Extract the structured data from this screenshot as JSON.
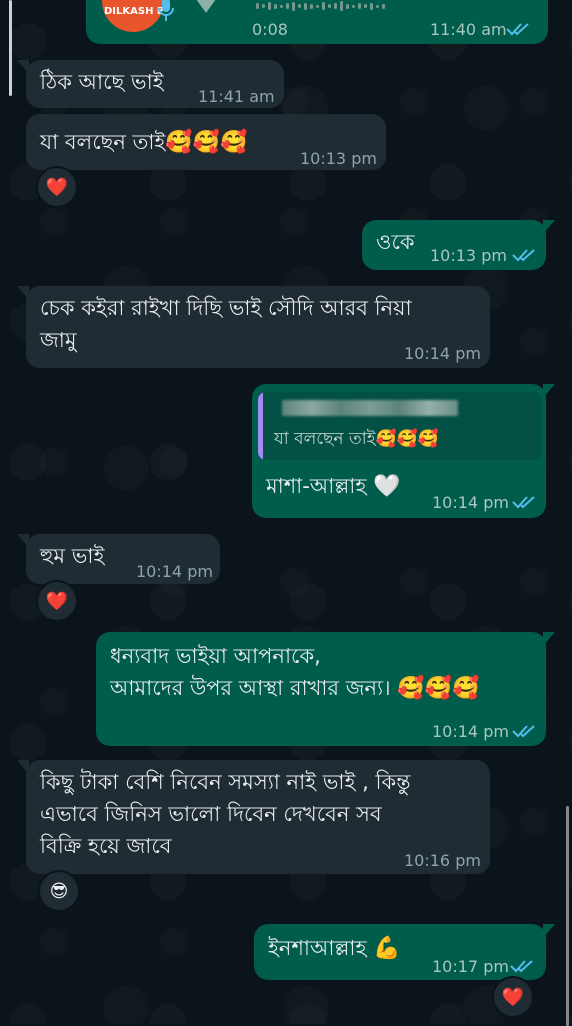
{
  "messages": [
    {
      "id": "audio",
      "dir": "out",
      "duration": "0:08",
      "time": "11:40 am",
      "logo_text": "DILKASH B"
    },
    {
      "id": "m1",
      "dir": "in",
      "text": "ঠিক আছে ভাই",
      "time": "11:41 am"
    },
    {
      "id": "m2",
      "dir": "in",
      "text": "যা বলছেন তাই",
      "emoji": "🥰🥰🥰",
      "time": "10:13 pm",
      "reaction": "❤️"
    },
    {
      "id": "m3",
      "dir": "out",
      "text": "ওকে",
      "time": "10:13 pm"
    },
    {
      "id": "m4",
      "dir": "in",
      "text": "চেক কইরা রাইখা দিছি ভাই সৌদি আরব  নিয়া\nজামু",
      "time": "10:14 pm"
    },
    {
      "id": "m5",
      "dir": "out",
      "quoted_text": "যা বলছেন তাই",
      "quoted_emoji": "🥰🥰🥰",
      "text": "মাশা-আল্লাহ",
      "emoji": "🤍",
      "time": "10:14 pm"
    },
    {
      "id": "m6",
      "dir": "in",
      "text": "হুম  ভাই",
      "time": "10:14 pm",
      "reaction": "❤️"
    },
    {
      "id": "m7",
      "dir": "out",
      "text": "ধন্যবাদ ভাইয়া আপনাকে,\nআমাদের উপর আস্থা রাখার জন্য।",
      "emoji": "🥰🥰🥰",
      "time": "10:14 pm"
    },
    {
      "id": "m8",
      "dir": "in",
      "text": "কিছু টাকা বেশি নিবেন সমস্যা  নাই  ভাই , কিন্তু\nএভাবে  জিনিস  ভালো দিবেন  দেখবেন সব\nবিক্রি  হয়ে জাবে",
      "time": "10:16 pm",
      "reaction": "😎"
    },
    {
      "id": "m9",
      "dir": "out",
      "text": "ইনশাআল্লাহ",
      "emoji": "💪",
      "time": "10:17 pm",
      "reaction": "❤️"
    }
  ],
  "colors": {
    "incoming": "#202c33",
    "outgoing": "#005c4b",
    "read_tick": "#53bdeb",
    "background": "#0b141a"
  }
}
